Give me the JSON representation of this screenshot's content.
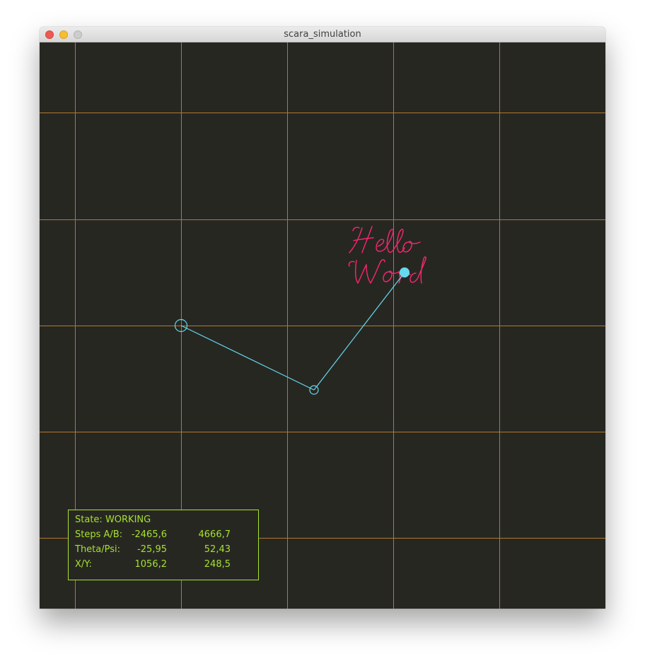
{
  "window": {
    "title": "scara_simulation"
  },
  "colors": {
    "background": "#272722",
    "grid": "#c7882e",
    "arm": "#66d9ef",
    "drawing": "#f92672",
    "info": "#a6e22e"
  },
  "drawing_text": {
    "line1": "Hello",
    "line2": "Word"
  },
  "info": {
    "state_label": "State:",
    "state_value": "WORKING",
    "steps_label": "Steps A/B:",
    "steps_a": "-2465,6",
    "steps_b": "4666,7",
    "angles_label": "Theta/Psi:",
    "theta": "-25,95",
    "psi": "52,43",
    "xy_label": "X/Y:",
    "x": "1056,2",
    "y": "248,5"
  }
}
